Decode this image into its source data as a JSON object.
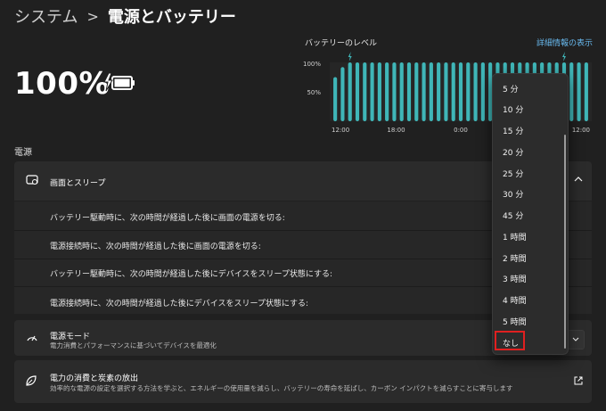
{
  "header": {
    "breadcrumb_root": "システム",
    "breadcrumb_sep": ">",
    "breadcrumb_current": "電源とバッテリー"
  },
  "battery": {
    "percent_text": "100%",
    "level_fraction": 1.0,
    "icon": "battery-charging-icon"
  },
  "chart": {
    "title": "バッテリーのレベル",
    "detail_link": "詳細情報の表示"
  },
  "chart_data": {
    "type": "bar",
    "title": "バッテリーのレベル",
    "y_ticks": [
      "100%",
      "50%"
    ],
    "x_ticks": [
      "12:00",
      "18:00",
      "0:00",
      "6:00",
      "12:00"
    ],
    "ylim": [
      0,
      100
    ],
    "values": [
      75,
      92,
      100,
      100,
      100,
      100,
      100,
      100,
      100,
      100,
      100,
      100,
      100,
      100,
      100,
      100,
      100,
      100,
      100,
      100,
      100,
      100,
      100,
      100,
      100,
      100,
      100,
      100,
      100,
      100,
      100,
      100,
      100,
      100,
      100
    ],
    "charging_markers": [
      2,
      31
    ],
    "color": "#3fb6b8"
  },
  "power": {
    "section_label": "電源",
    "screen_sleep": {
      "title": "画面とスリープ",
      "rows": [
        "バッテリー駆動時に、次の時間が経過した後に画面の電源を切る:",
        "電源接続時に、次の時間が経過した後に画面の電源を切る:",
        "バッテリー駆動時に、次の時間が経過した後にデバイスをスリープ状態にする:",
        "電源接続時に、次の時間が経過した後にデバイスをスリープ状態にする:"
      ]
    },
    "mode": {
      "title": "電源モード",
      "subtitle": "電力消費とパフォーマンスに基づいてデバイスを最適化"
    },
    "eco": {
      "title": "電力の消費と炭素の放出",
      "subtitle": "効率的な電源の設定を選択する方法を学ぶと、エネルギーの使用量を減らし、バッテリーの寿命を延ばし、カーボン インパクトを減らすことに寄与します"
    }
  },
  "dropdown": {
    "options": [
      "5 分",
      "10 分",
      "15 分",
      "20 分",
      "25 分",
      "30 分",
      "45 分",
      "1 時間",
      "2 時間",
      "3 時間",
      "4 時間",
      "5 時間",
      "なし"
    ],
    "highlighted": "なし",
    "highlight_color": "#e02020"
  }
}
